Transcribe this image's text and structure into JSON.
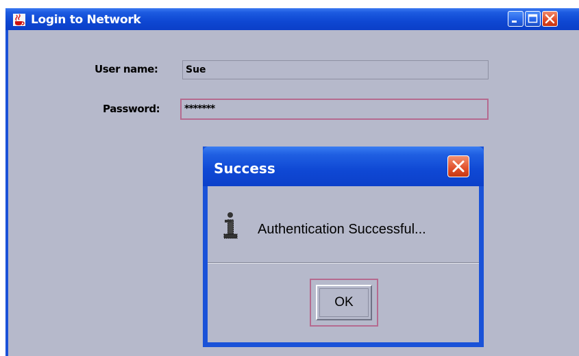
{
  "main_window": {
    "title": "Login to Network",
    "title_icon": "java-cup-icon"
  },
  "form": {
    "username_label": "User name:",
    "username_value": "Sue",
    "password_label": "Password:",
    "password_value": "*******"
  },
  "dialog": {
    "title": "Success",
    "message": "Authentication Successful...",
    "icon": "info-icon",
    "ok_label": "OK"
  },
  "colors": {
    "titlebar_blue": "#0e47d2",
    "client_bg": "#b6b9cb",
    "focus_border": "#b56a8f",
    "close_red": "#e04a26"
  }
}
